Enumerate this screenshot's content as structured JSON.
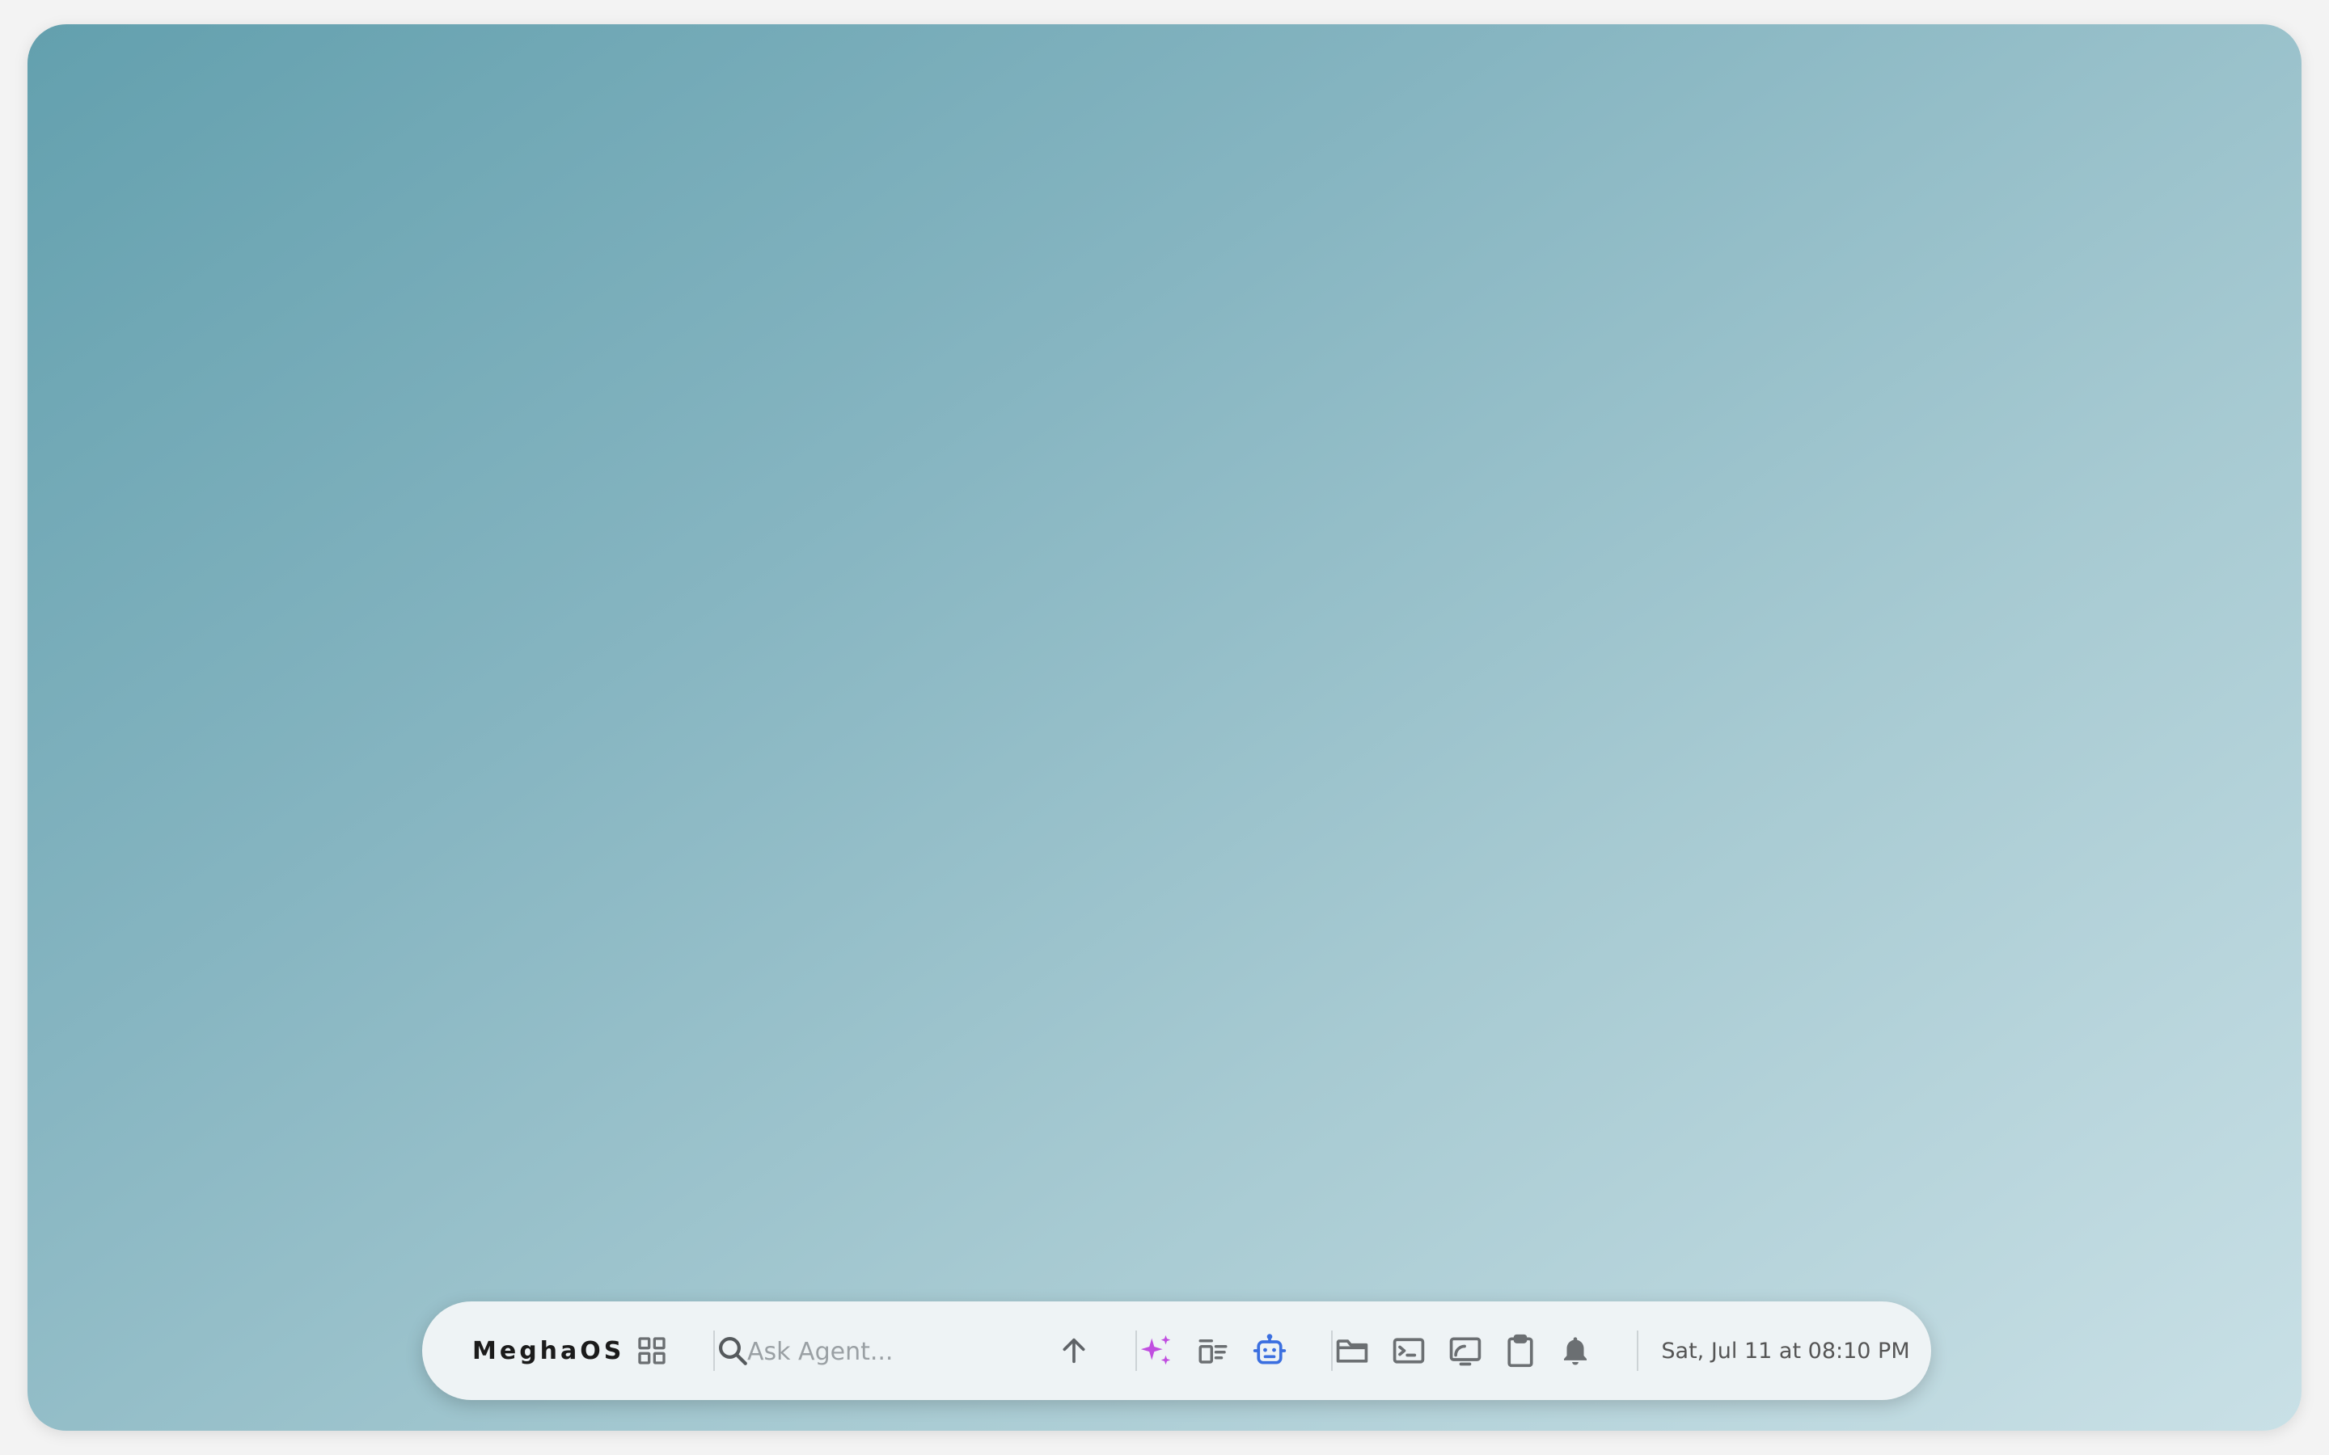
{
  "taskbar": {
    "brand": "MeghaOS",
    "search": {
      "placeholder": "Ask Agent...",
      "value": ""
    },
    "datetime": "Sat, Jul 11 at 08:10 PM",
    "icons": {
      "apps": "grid-icon",
      "search": "search-icon",
      "send": "arrow-up-icon",
      "ai": "sparkle-icon",
      "tasks": "task-list-icon",
      "agent": "robot-icon",
      "files": "folder-icon",
      "terminal": "terminal-icon",
      "screen": "screen-cast-icon",
      "clipboard": "clipboard-icon",
      "notifications": "bell-icon"
    }
  },
  "colors": {
    "ai_accent": "#c04ee0",
    "agent_accent": "#3b6fe0",
    "icon_gray": "#6b6f72",
    "taskbar_bg": "#eef3f5"
  }
}
